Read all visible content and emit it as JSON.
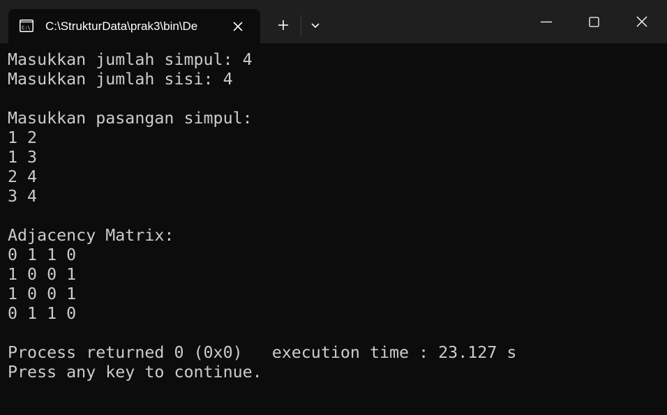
{
  "window": {
    "tab_title": "C:\\StrukturData\\prak3\\bin\\De",
    "tab_icon": "console-icon",
    "accent_bg": "#0c0c0c",
    "titlebar_bg": "#1f1f1f",
    "text_color": "#cccccc"
  },
  "console": {
    "lines": [
      "Masukkan jumlah simpul: 4",
      "Masukkan jumlah sisi: 4",
      "",
      "Masukkan pasangan simpul:",
      "1 2",
      "1 3",
      "2 4",
      "3 4",
      "",
      "Adjacency Matrix:",
      "0 1 1 0",
      "1 0 0 1",
      "1 0 0 1",
      "0 1 1 0",
      "",
      "Process returned 0 (0x0)   execution time : 23.127 s",
      "Press any key to continue."
    ]
  }
}
